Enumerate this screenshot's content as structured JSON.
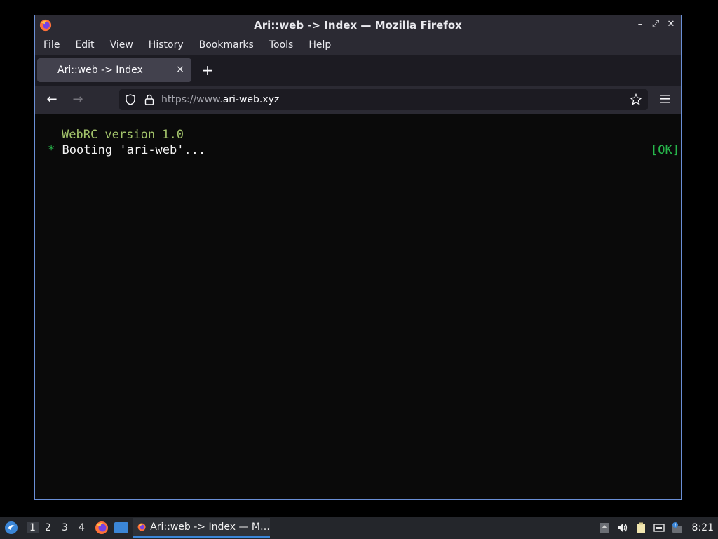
{
  "window": {
    "title": "Ari::web -> Index — Mozilla Firefox",
    "controls": {
      "minimize": "–",
      "maximize": "⤢",
      "close": "✕"
    }
  },
  "menubar": {
    "items": [
      "File",
      "Edit",
      "View",
      "History",
      "Bookmarks",
      "Tools",
      "Help"
    ]
  },
  "tab": {
    "label": "Ari::web -> Index",
    "close": "×",
    "new_tab": "+"
  },
  "nav": {
    "back": "←",
    "forward": "→"
  },
  "urlbar": {
    "prefix": "https://www.",
    "domain": "ari-web.xyz"
  },
  "content": {
    "version_line": "WebRC version 1.0",
    "boot_bullet": "*",
    "boot_line": "Booting 'ari-web'...",
    "status": "[OK]"
  },
  "taskbar": {
    "workspaces": [
      "1",
      "2",
      "3",
      "4"
    ],
    "active_task_label": "Ari::web -> Index — M…",
    "clock": "8:21"
  },
  "colors": {
    "accent": "#3b86d7",
    "version_text": "#a3c46b",
    "ok_green": "#27b64b",
    "window_border": "#6a8fd6"
  },
  "icons": [
    "firefox-icon",
    "shield-icon",
    "lock-icon",
    "star-icon",
    "hamburger-icon",
    "start-menu-icon",
    "desktop-icon",
    "volume-icon",
    "clipboard-icon",
    "network-icon",
    "notification-icon"
  ]
}
